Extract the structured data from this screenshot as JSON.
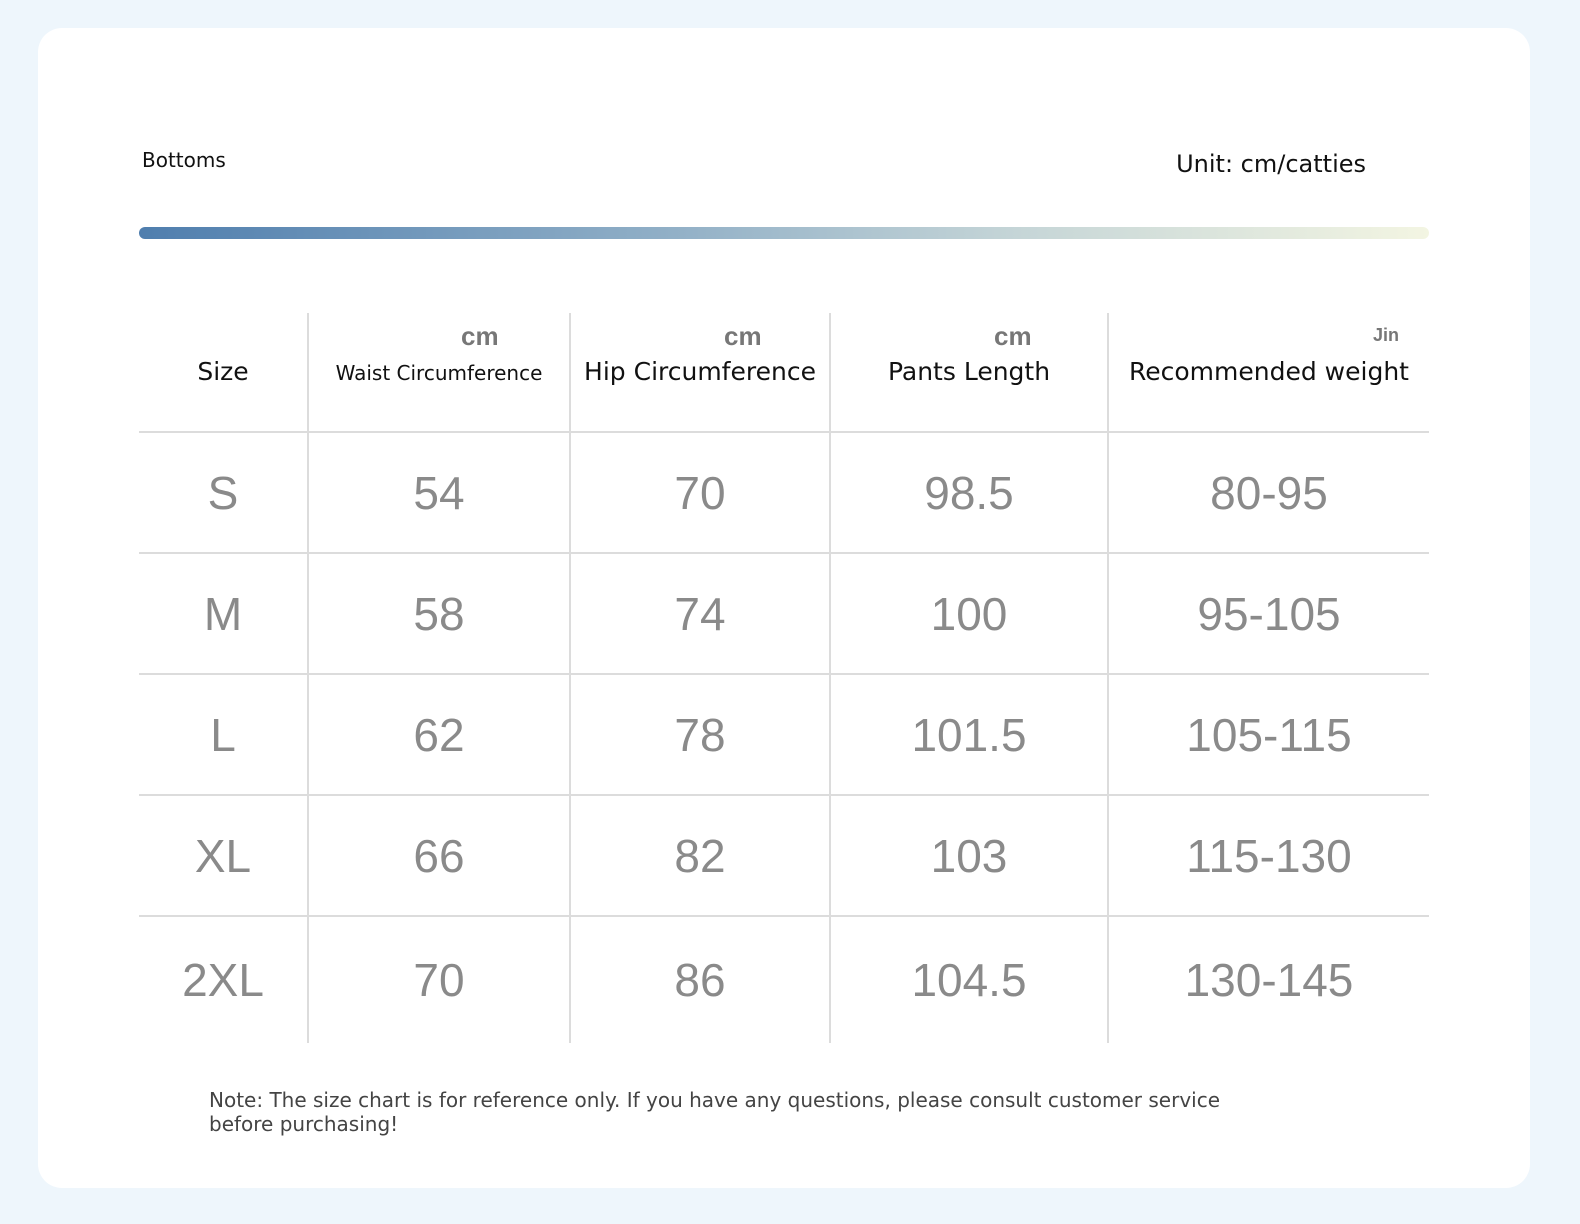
{
  "header": {
    "section_title": "Bottoms",
    "unit_label": "Unit: cm/catties"
  },
  "colors": {
    "bar_start": "#4f7eae",
    "bar_end": "#f3f5e2",
    "cell_text": "#8a8a8a",
    "grid_line": "#dcdcdc"
  },
  "table": {
    "columns": [
      {
        "label": "Size",
        "unit": ""
      },
      {
        "label": "Waist Circumference",
        "unit": "cm"
      },
      {
        "label": "Hip Circumference",
        "unit": "cm"
      },
      {
        "label": "Pants Length",
        "unit": "cm"
      },
      {
        "label": "Recommended weight",
        "unit": "Jin"
      }
    ],
    "rows": [
      [
        "S",
        "54",
        "70",
        "98.5",
        "80-95"
      ],
      [
        "M",
        "58",
        "74",
        "100",
        "95-105"
      ],
      [
        "L",
        "62",
        "78",
        "101.5",
        "105-115"
      ],
      [
        "XL",
        "66",
        "82",
        "103",
        "115-130"
      ],
      [
        "2XL",
        "70",
        "86",
        "104.5",
        "130-145"
      ]
    ]
  },
  "note": "Note: The size chart is for reference only. If you have any questions, please consult customer service before purchasing!"
}
